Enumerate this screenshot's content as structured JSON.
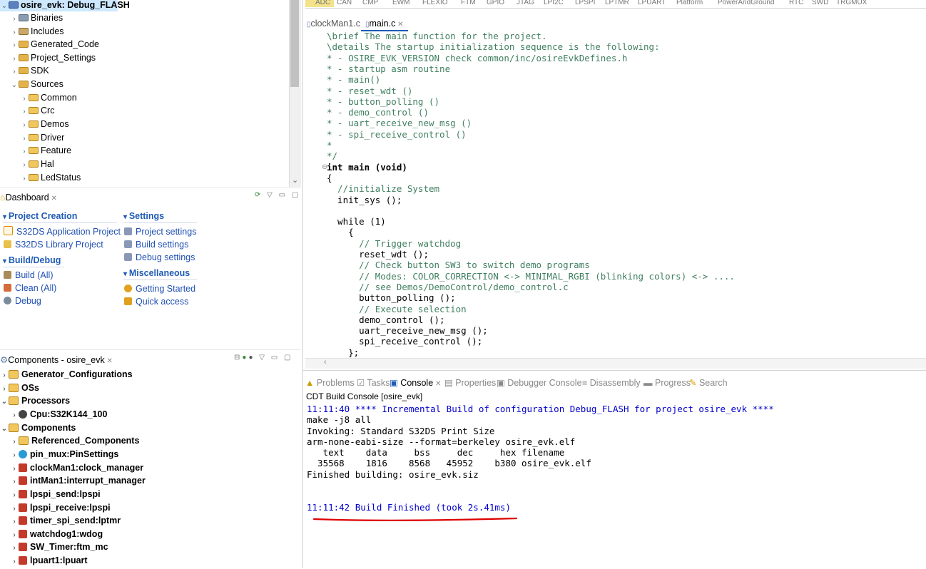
{
  "project_tree": {
    "root": "osire_evk: Debug_FLASH",
    "items": [
      "Binaries",
      "Includes",
      "Generated_Code",
      "Project_Settings",
      "SDK",
      "Sources"
    ],
    "sources_children": [
      "Common",
      "Crc",
      "Demos",
      "Driver",
      "Feature",
      "Hal",
      "LedStatus"
    ]
  },
  "dashboard": {
    "title": "Dashboard",
    "sections": {
      "project_creation": "Project Creation",
      "build_debug": "Build/Debug",
      "settings": "Settings",
      "misc": "Miscellaneous"
    },
    "links": {
      "app_project": "S32DS Application Project",
      "lib_project": "S32DS Library Project",
      "build_all": "Build  (All)",
      "clean_all": "Clean  (All)",
      "debug": "Debug",
      "project_settings": "Project settings",
      "build_settings": "Build settings",
      "debug_settings": "Debug settings",
      "getting_started": "Getting Started",
      "quick_access": "Quick access"
    }
  },
  "components": {
    "title": "Components - osire_evk",
    "items": [
      "Generator_Configurations",
      "OSs",
      "Processors",
      "Cpu:S32K144_100",
      "Components",
      "Referenced_Components",
      "pin_mux:PinSettings",
      "clockMan1:clock_manager",
      "intMan1:interrupt_manager",
      "lpspi_send:lpspi",
      "lpspi_receive:lpspi",
      "timer_spi_send:lptmr",
      "watchdog1:wdog",
      "SW_Timer:ftm_mc",
      "lpuart1:lpuart"
    ]
  },
  "peripheral_tabs": [
    "ADC",
    "CAN",
    "CMP",
    "EWM",
    "FLEXIO",
    "FTM",
    "GPIO",
    "JTAG",
    "LPI2C",
    "LPSPI",
    "LPTMR",
    "LPUART",
    "Platform",
    "PowerAndGround",
    "RTC",
    "SWD",
    "TRGMUX"
  ],
  "editor": {
    "tabs": [
      "clockMan1.c",
      "main.c"
    ],
    "lines": [
      "\\brief The main function for the project.",
      "\\details The startup initialization sequence is the following:",
      "* - OSIRE_EVK_VERSION check common/inc/osireEvkDefines.h",
      "* - startup asm routine",
      "* - main()",
      "* - reset_wdt ()",
      "* - button_polling ()",
      "* - demo_control ()",
      "* - uart_receive_new_msg ()",
      "* - spi_receive_control ()",
      "*",
      "*/",
      "int main (void)",
      "{",
      "  //initialize System",
      "  init_sys ();",
      "",
      "  while (1)",
      "    {",
      "      // Trigger watchdog",
      "      reset_wdt ();",
      "      // Check button SW3 to switch demo programs",
      "      // Modes: COLOR_CORRECTION <-> MINIMAL_RGBI (blinking colors) <-> ....",
      "      // see Demos/DemoControl/demo_control.c",
      "      button_polling ();",
      "      // Execute selection",
      "      demo_control ();",
      "      uart_receive_new_msg ();",
      "      spi_receive_control ();",
      "    };"
    ]
  },
  "console": {
    "tabs": [
      "Problems",
      "Tasks",
      "Console",
      "Properties",
      "Debugger Console",
      "Disassembly",
      "Progress",
      "Search"
    ],
    "label": "CDT Build Console [osire_evk]",
    "lines": [
      "11:11:40 **** Incremental Build of configuration Debug_FLASH for project osire_evk ****",
      "make -j8 all",
      "Invoking: Standard S32DS Print Size",
      "arm-none-eabi-size --format=berkeley osire_evk.elf",
      "   text    data     bss     dec     hex filename",
      "  35568    1816    8568   45952    b380 osire_evk.elf",
      "Finished building: osire_evk.siz",
      "",
      "",
      "11:11:42 Build Finished (took 2s.41ms)"
    ]
  },
  "colors": {
    "accent": "#1f5bb5",
    "console_blue": "#0000cc",
    "comment": "#3f7f5f",
    "keyword": "#7f0055",
    "annotation": "#dd0000"
  }
}
